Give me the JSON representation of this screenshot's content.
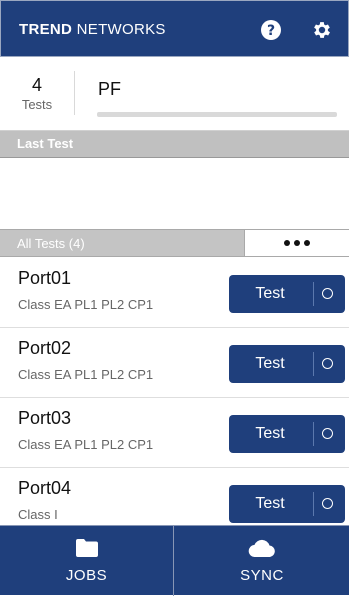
{
  "header": {
    "brand_bold": "TREND",
    "brand_regular": "NETWORKS",
    "icons": {
      "help": "help-circle-icon",
      "settings": "gear-icon"
    }
  },
  "summary": {
    "count": "4",
    "count_label": "Tests",
    "result": "PF",
    "progress": 0
  },
  "last_test": {
    "label": "Last Test"
  },
  "all_tests": {
    "label": "All Tests (4)",
    "more_icon": "more-dots-icon"
  },
  "tests": [
    {
      "port": "Port01",
      "class": "Class EA PL1 PL2 CP1",
      "button": "Test"
    },
    {
      "port": "Port02",
      "class": "Class EA PL1 PL2 CP1",
      "button": "Test"
    },
    {
      "port": "Port03",
      "class": "Class EA PL1 PL2 CP1",
      "button": "Test"
    },
    {
      "port": "Port04",
      "class": "Class I",
      "button": "Test"
    }
  ],
  "footer": {
    "jobs": {
      "label": "JOBS",
      "icon": "folder-icon"
    },
    "sync": {
      "label": "SYNC",
      "icon": "cloud-icon"
    }
  },
  "colors": {
    "primary": "#1f3f7c",
    "section_bar": "#c0c0c0"
  }
}
